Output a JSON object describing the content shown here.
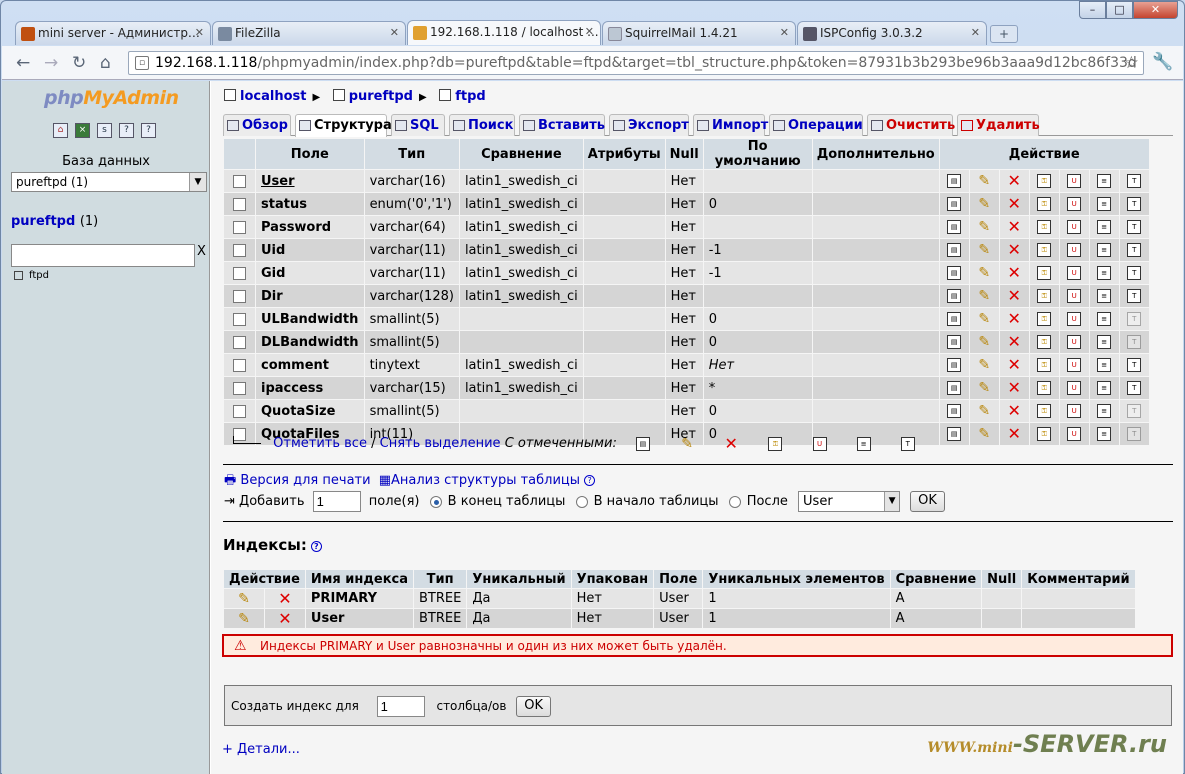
{
  "browser": {
    "tabs": [
      {
        "title": "mini server - Администр…",
        "color": "#c05010"
      },
      {
        "title": "FileZilla",
        "color": "#7a8aa0"
      },
      {
        "title": "192.168.1.118 / localhost ...",
        "color": "#e0a030"
      },
      {
        "title": "SquirrelMail 1.4.21",
        "color": "#9ab"
      },
      {
        "title": "ISPConfig 3.0.3.2",
        "color": "#556"
      }
    ],
    "url_host": "192.168.1.118",
    "url_rest": "/phpmyadmin/index.php?db=pureftpd&table=ftpd&target=tbl_structure.php&token=87931b3b293be96b3aaa9d12bc86f33d"
  },
  "sidebar": {
    "logo_php": "php",
    "logo_my": "MyAdmin",
    "db_label": "База данных",
    "db_select": "pureftpd (1)",
    "db_link": "pureftpd",
    "db_count": "(1)",
    "filter_clear": "X",
    "table_item": "ftpd"
  },
  "breadcrumb": {
    "server": "localhost",
    "db": "pureftpd",
    "table": "ftpd"
  },
  "page_tabs": [
    {
      "label": "Обзор"
    },
    {
      "label": "Структура"
    },
    {
      "label": "SQL"
    },
    {
      "label": "Поиск"
    },
    {
      "label": "Вставить"
    },
    {
      "label": "Экспорт"
    },
    {
      "label": "Импорт"
    },
    {
      "label": "Операции"
    },
    {
      "label": "Очистить"
    },
    {
      "label": "Удалить"
    }
  ],
  "structure": {
    "headers": [
      "Поле",
      "Тип",
      "Сравнение",
      "Атрибуты",
      "Null",
      "По умолчанию",
      "Дополнительно",
      "Действие"
    ],
    "rows": [
      {
        "field": "User",
        "type": "varchar(16)",
        "collation": "latin1_swedish_ci",
        "attributes": "",
        "null": "Нет",
        "default": "",
        "extra": ""
      },
      {
        "field": "status",
        "type": "enum('0','1')",
        "collation": "latin1_swedish_ci",
        "attributes": "",
        "null": "Нет",
        "default": "0",
        "extra": ""
      },
      {
        "field": "Password",
        "type": "varchar(64)",
        "collation": "latin1_swedish_ci",
        "attributes": "",
        "null": "Нет",
        "default": "",
        "extra": ""
      },
      {
        "field": "Uid",
        "type": "varchar(11)",
        "collation": "latin1_swedish_ci",
        "attributes": "",
        "null": "Нет",
        "default": "-1",
        "extra": ""
      },
      {
        "field": "Gid",
        "type": "varchar(11)",
        "collation": "latin1_swedish_ci",
        "attributes": "",
        "null": "Нет",
        "default": "-1",
        "extra": ""
      },
      {
        "field": "Dir",
        "type": "varchar(128)",
        "collation": "latin1_swedish_ci",
        "attributes": "",
        "null": "Нет",
        "default": "",
        "extra": ""
      },
      {
        "field": "ULBandwidth",
        "type": "smallint(5)",
        "collation": "",
        "attributes": "",
        "null": "Нет",
        "default": "0",
        "extra": ""
      },
      {
        "field": "DLBandwidth",
        "type": "smallint(5)",
        "collation": "",
        "attributes": "",
        "null": "Нет",
        "default": "0",
        "extra": ""
      },
      {
        "field": "comment",
        "type": "tinytext",
        "collation": "latin1_swedish_ci",
        "attributes": "",
        "null": "Нет",
        "default": "Нет",
        "extra": ""
      },
      {
        "field": "ipaccess",
        "type": "varchar(15)",
        "collation": "latin1_swedish_ci",
        "attributes": "",
        "null": "Нет",
        "default": "*",
        "extra": ""
      },
      {
        "field": "QuotaSize",
        "type": "smallint(5)",
        "collation": "",
        "attributes": "",
        "null": "Нет",
        "default": "0",
        "extra": ""
      },
      {
        "field": "QuotaFiles",
        "type": "int(11)",
        "collation": "",
        "attributes": "",
        "null": "Нет",
        "default": "0",
        "extra": ""
      }
    ]
  },
  "check_actions": {
    "check_all": "Отметить все",
    "separator": "/",
    "uncheck_all": "Снять выделение",
    "with_selected": "С отмеченными:"
  },
  "print_link": "Версия для печати",
  "analyze_link": "Анализ структуры таблицы",
  "add_fields": {
    "label": "Добавить",
    "count": "1",
    "fields_label": "поле(я)",
    "at_end": "В конец таблицы",
    "at_begin": "В начало таблицы",
    "after": "После",
    "after_select": "User",
    "ok": "OK"
  },
  "indexes": {
    "title": "Индексы:",
    "headers": [
      "Действие",
      "Имя индекса",
      "Тип",
      "Уникальный",
      "Упакован",
      "Поле",
      "Уникальных элементов",
      "Сравнение",
      "Null",
      "Комментарий"
    ],
    "rows": [
      {
        "name": "PRIMARY",
        "type": "BTREE",
        "unique": "Да",
        "packed": "Нет",
        "field": "User",
        "cardinality": "1",
        "collation": "A",
        "null": "",
        "comment": ""
      },
      {
        "name": "User",
        "type": "BTREE",
        "unique": "Да",
        "packed": "Нет",
        "field": "User",
        "cardinality": "1",
        "collation": "A",
        "null": "",
        "comment": ""
      }
    ]
  },
  "warning": "Индексы PRIMARY и User равнозначны и один из них может быть удалён.",
  "create_index": {
    "label": "Создать индекс для",
    "count": "1",
    "suffix": "столбца/ов",
    "ok": "OK"
  },
  "details_link": "+ Детали...",
  "watermark": {
    "prefix": "WWW.",
    "mini": "mini",
    "suffix": "-SERVER.ru"
  }
}
